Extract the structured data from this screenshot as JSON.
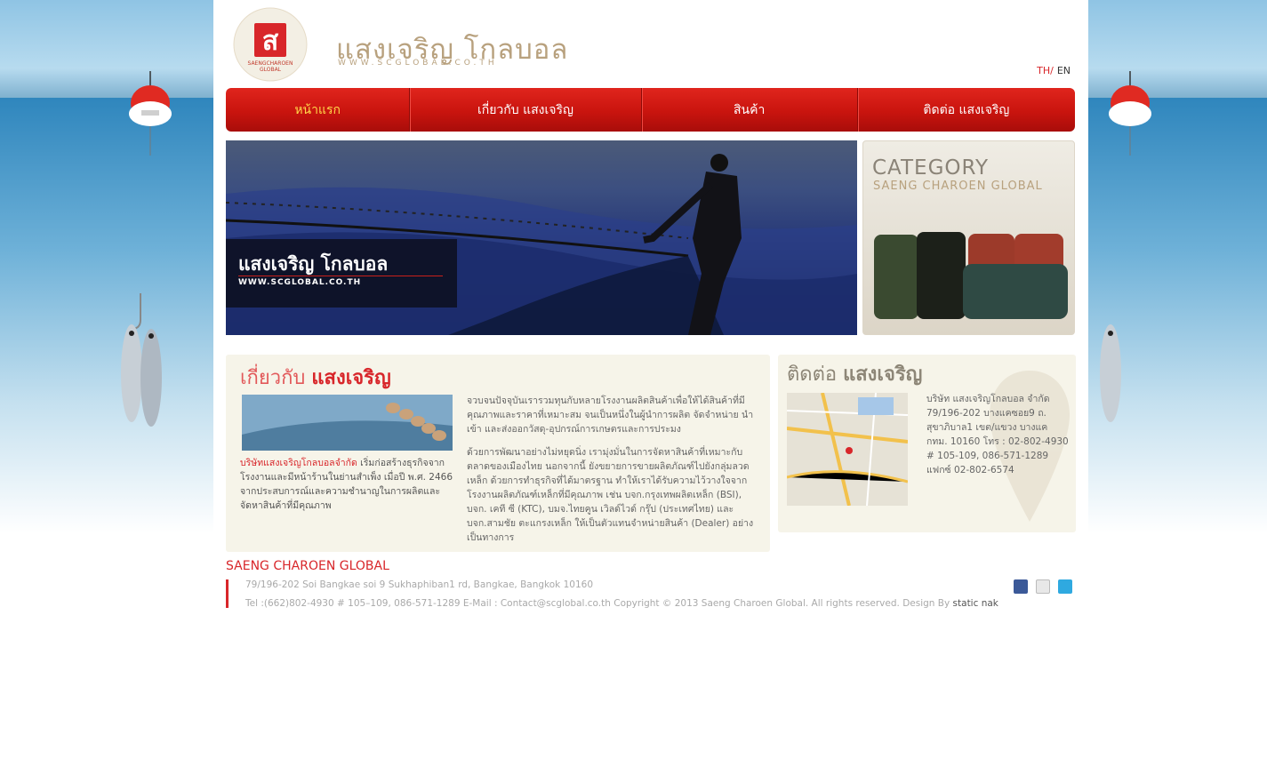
{
  "header": {
    "brand": "แสงเจริญ โกลบอล",
    "brand_url": "WWW.SCGLOBAL.CO.TH",
    "logo_text": "SAENGCHAROEN GLOBAL",
    "lang_th": "TH/",
    "lang_en": "EN"
  },
  "nav": [
    {
      "label": "หน้าแรก",
      "active": true
    },
    {
      "label": "เกี่ยวกับ แสงเจริญ"
    },
    {
      "label": "สินค้า"
    },
    {
      "label": "ติดต่อ แสงเจริญ"
    }
  ],
  "banner": {
    "title": "แสงเจริญ โกลบอล",
    "url": "WWW.SCGLOBAL.CO.TH"
  },
  "category": {
    "title": "CATEGORY",
    "subtitle": "SAENG CHAROEN GLOBAL"
  },
  "about": {
    "title_light": "เกี่ยวกับ",
    "title_bold": "แสงเจริญ",
    "company": "บริษัทแสงเจริญโกลบอลจำกัด",
    "intro": " เริ่มก่อสร้างธุรกิจจาก โรงงานและมีหน้าร้านในย่านสำเพ็ง เมื่อปี พ.ศ. 2466 จากประสบการณ์และความชำนาญในการผลิตและ จัดหาสินค้าที่มีคุณภาพ",
    "para1": "จวบจนปัจจุบันเรารวมทุนกับหลายโรงงานผลิตสินค้าเพื่อให้ได้สินค้าที่มีคุณภาพและราคาที่เหมาะสม จนเป็นหนึ่งในผู้นำการผลิต จัดจำหน่าย นำเข้า และส่งออกวัสดุ-อุปกรณ์การเกษตรและการประมง",
    "para2": "ด้วยการพัฒนาอย่างไม่หยุดนิ่ง เรามุ่งมั่นในการจัดหาสินค้าที่เหมาะกับตลาดของเมืองไทย นอกจากนี้ ยังขยายการขายผลิตภัณฑ์ไปยังกลุ่มลวดเหล็ก ด้วยการทำธุรกิจที่ได้มาตรฐาน ทำให้เราได้รับความไว้วางใจจาก โรงงานผลิตภัณฑ์เหล็กที่มีคุณภาพ เช่น บจก.กรุงเทพผลิตเหล็ก (BSI), บจก. เคที ซี (KTC), บมจ.ไทยคูน เวิลด์ไวด์ กรุ๊ป (ประเทศไทย) และ บจก.สามชัย ตะแกรงเหล็ก ให้เป็นตัวแทนจำหน่ายสินค้า (Dealer) อย่างเป็นทางการ"
  },
  "contact": {
    "title_light": "ติดต่อ",
    "title_bold": "แสงเจริญ",
    "lines": [
      "บริษัท แสงเจริญโกลบอล จำกัด",
      "79/196-202 บางแคซอย9 ถ.",
      "สุขาภิบาล1 เขต/แขวง บางแค",
      "กทม. 10160 โทร : 02-802-4930",
      "# 105-109, 086-571-1289",
      "แฟกซ์ 02-802-6574"
    ]
  },
  "footer": {
    "title": "SAENG CHAROEN GLOBAL",
    "address": "79/196-202 Soi Bangkae soi 9 Sukhaphiban1 rd, Bangkae, Bangkok 10160",
    "tel": "Tel :(662)802-4930 # 105–109, 086-571-1289 E-Mail : Contact@scglobal.co.th Copyright © 2013 Saeng Charoen Global. All rights reserved. Design By ",
    "designer": "static nak"
  },
  "colors": {
    "accent": "#d8262a",
    "gold": "#b8a17e",
    "panel": "#f6f4e9"
  },
  "social": [
    "facebook-icon",
    "email-icon",
    "twitter-icon"
  ]
}
